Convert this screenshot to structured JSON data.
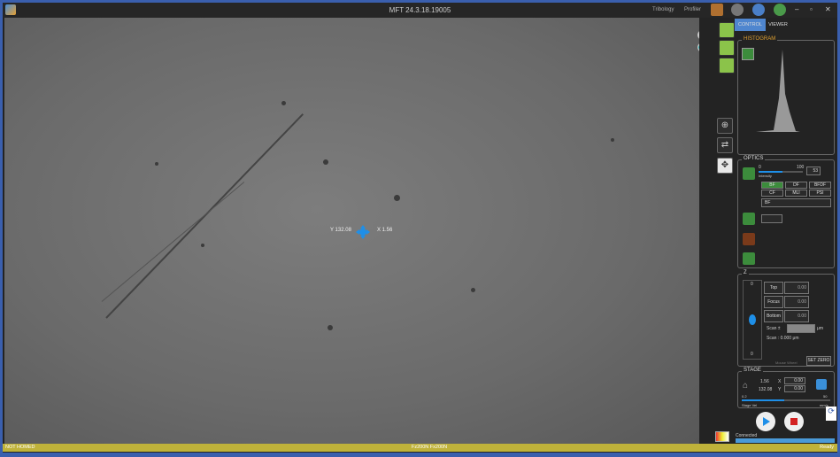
{
  "window": {
    "title": "MFT 24.3.18.19005",
    "menu": [
      "Tribology",
      "Profiler"
    ],
    "minimize": "–",
    "restore": "▫",
    "close": "✕"
  },
  "viewer": {
    "y_label": "Y 132.08",
    "x_label": "X 1.56"
  },
  "tabs": {
    "control": "CONTROL",
    "viewer": "VIEWER"
  },
  "histogram": {
    "label": "HISTOGRAM"
  },
  "optics": {
    "label": "OPTICS",
    "intensity_label": "Intensity",
    "intensity_min": "0",
    "intensity_max": "100",
    "intensity_value": "53",
    "intensity_fraction": 0.53,
    "modes": [
      "BF",
      "DF",
      "BFDF",
      "CF",
      "MLI",
      "PSI"
    ],
    "active_mode": "BF",
    "mode_select": "BF",
    "objective_select": ""
  },
  "z": {
    "label": "Z",
    "top": "Top",
    "focus": "Focus",
    "bottom": "Bottom",
    "top_value": "0.00",
    "focus_value": "0.00",
    "bottom_value": "0.00",
    "scan_label": "Scan ±",
    "scan_unit": "μm",
    "scan_readout": "Scan : 0.000 μm",
    "scale_top": "0",
    "scale_bottom": "0",
    "mouse_wheel": "Mouse Wheel",
    "set_zero": "SET ZERO"
  },
  "stage": {
    "label": "STAGE",
    "x_pos": "1.56",
    "y_pos": "132.08",
    "x_label": "X",
    "y_label": "Y",
    "x_value": "0.00",
    "y_value": "0.00",
    "speed_min": "0.2",
    "speed_max": "50",
    "speed_label": "Stage Vel",
    "speed_unit": "mm/s"
  },
  "connection": "Connected",
  "status": {
    "left": "NOT HOMED",
    "center": "Fz200N Fx200N",
    "right": "Ready"
  },
  "colors": {
    "accent": "#3a5fae",
    "green": "#8bc34a",
    "status": "#bfb23a",
    "tab": "#4f86cf"
  }
}
